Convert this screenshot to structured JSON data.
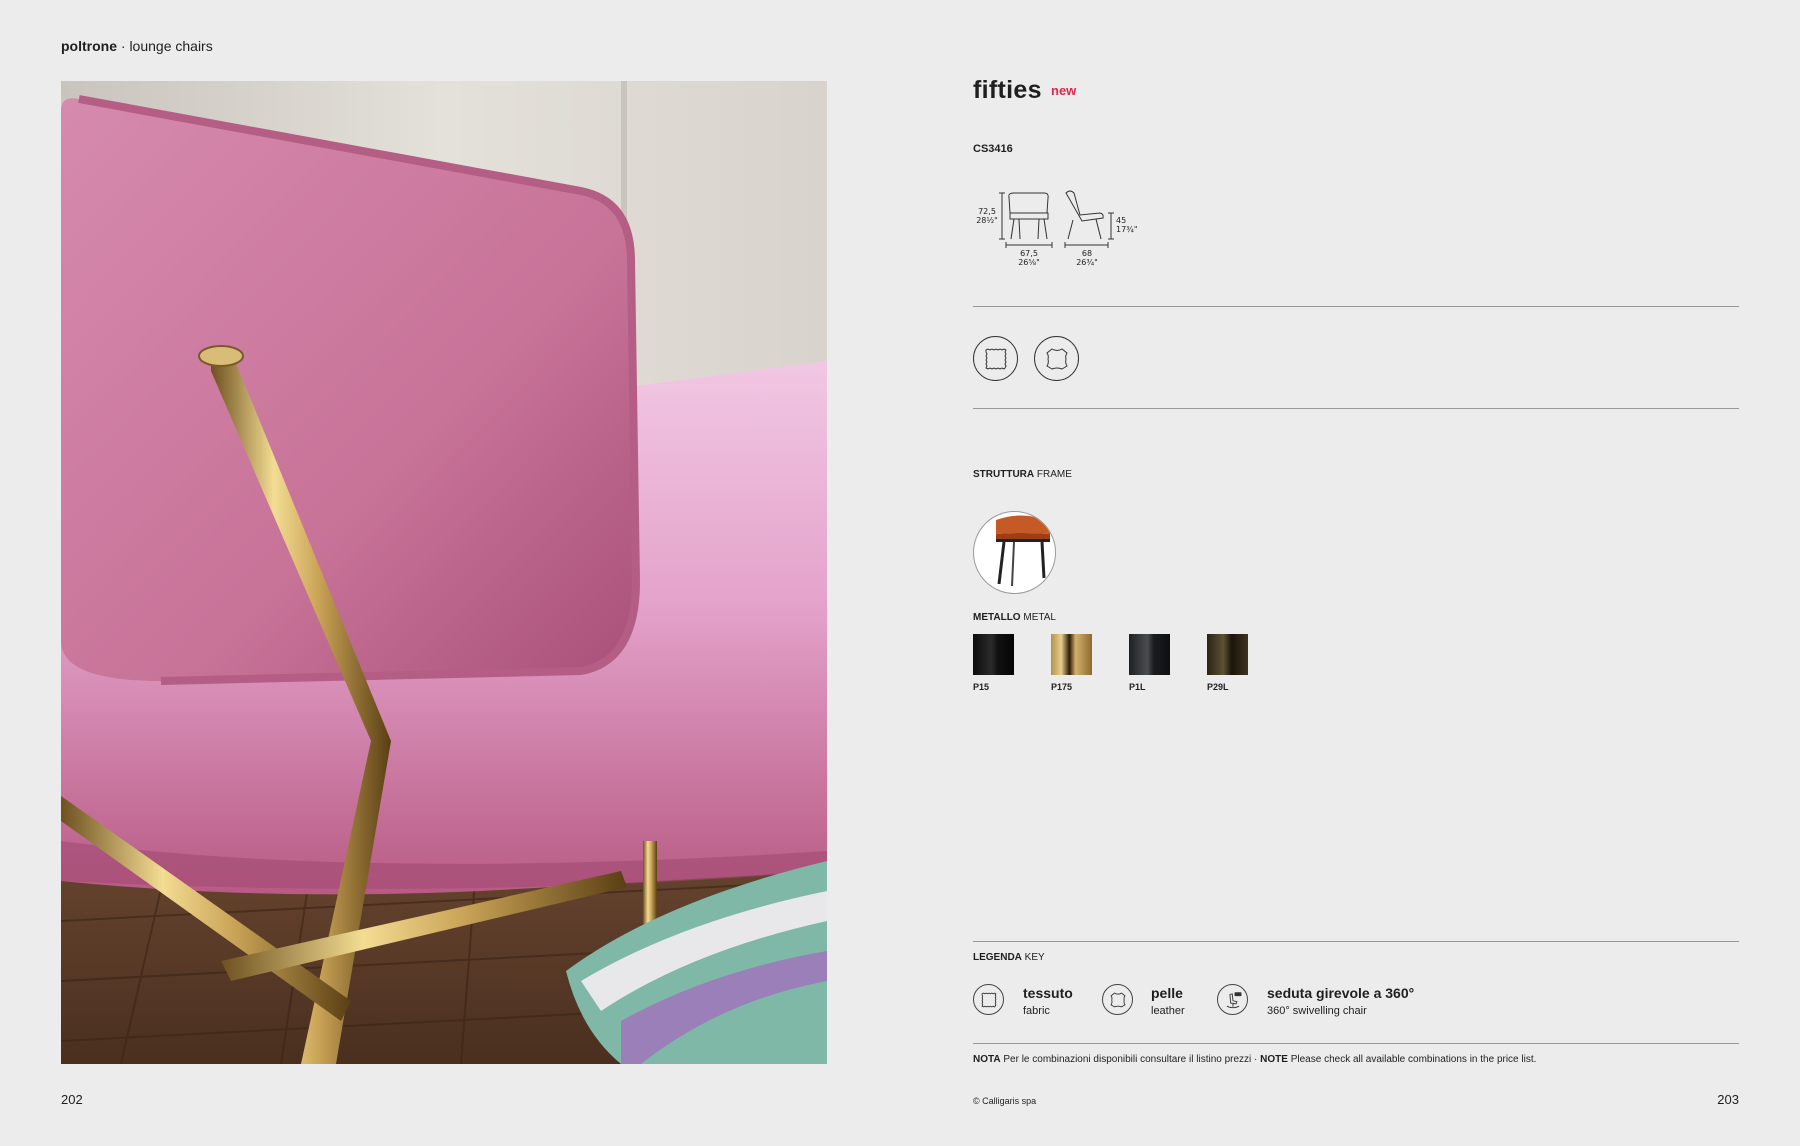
{
  "header": {
    "bold": "poltrone",
    "rest": " · lounge chairs"
  },
  "page_numbers": {
    "left": "202",
    "right": "203"
  },
  "product": {
    "name": "fifties",
    "badge": "new",
    "code": "CS3416",
    "dimensions": {
      "height_cm": "72,5",
      "height_in": "28½\"",
      "width_cm": "67,5",
      "width_in": "26⅝\"",
      "depth_cm": "68",
      "depth_in": "26¾\"",
      "seat_cm": "45",
      "seat_in": "17¾\""
    }
  },
  "materials": [
    {
      "icon": "fabric-icon"
    },
    {
      "icon": "leather-icon"
    }
  ],
  "frame": {
    "label_bold": "STRUTTURA",
    "label": " FRAME",
    "image": "chair-frame-thumbnail"
  },
  "metal": {
    "label_bold": "METALLO",
    "label": " METAL",
    "swatches": [
      {
        "code": "P15",
        "color": "#151515"
      },
      {
        "code": "P175",
        "color": "#b08a4f"
      },
      {
        "code": "P1L",
        "color": "#2a2c2e"
      },
      {
        "code": "P29L",
        "color": "#3a3222"
      }
    ]
  },
  "legend": {
    "label_bold": "LEGENDA",
    "label": " KEY",
    "items": [
      {
        "icon": "fabric-icon",
        "main": "tessuto",
        "sub": "fabric"
      },
      {
        "icon": "leather-icon",
        "main": "pelle",
        "sub": "leather"
      },
      {
        "icon": "swivel-360-icon",
        "main": "seduta girevole a 360°",
        "sub": "360° swivelling chair"
      }
    ]
  },
  "note": {
    "bold1": "NOTA",
    "text1": " Per le combinazioni disponibili consultare il listino prezzi · ",
    "bold2": "NOTE",
    "text2": " Please check all available combinations in the price list."
  },
  "copyright": "© Calligaris spa",
  "colors": {
    "accent": "#e2284a",
    "background": "#ececec",
    "velvet": "#c86f95",
    "brass": "#c9a356"
  }
}
